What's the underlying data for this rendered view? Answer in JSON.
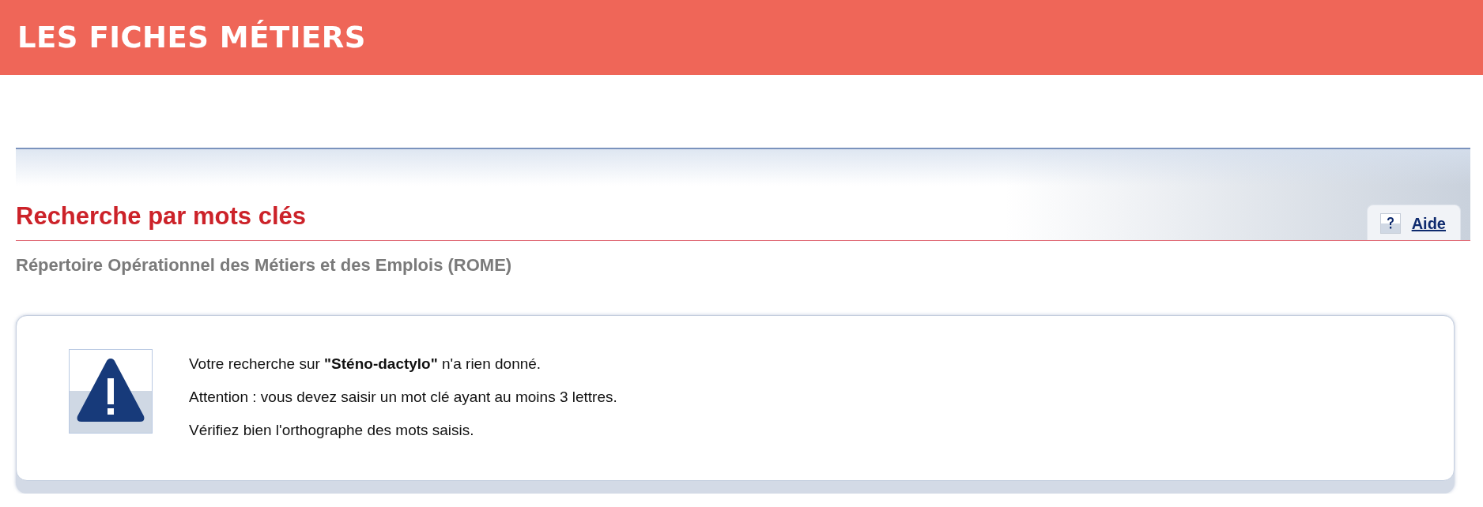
{
  "header": {
    "title": "LES FICHES MÉTIERS"
  },
  "section": {
    "heading": "Recherche par mots clés",
    "help_link": "Aide",
    "subtitle": "Répertoire Opérationnel des Métiers et des Emplois (ROME)"
  },
  "message": {
    "lines": [
      "Votre recherche sur **\"Sténo-dactylo\"** n'a rien donné.",
      "Attention : vous devez saisir un mot clé ayant au moins 3 lettres.",
      "Vérifiez bien l'orthographe des mots saisis."
    ]
  }
}
